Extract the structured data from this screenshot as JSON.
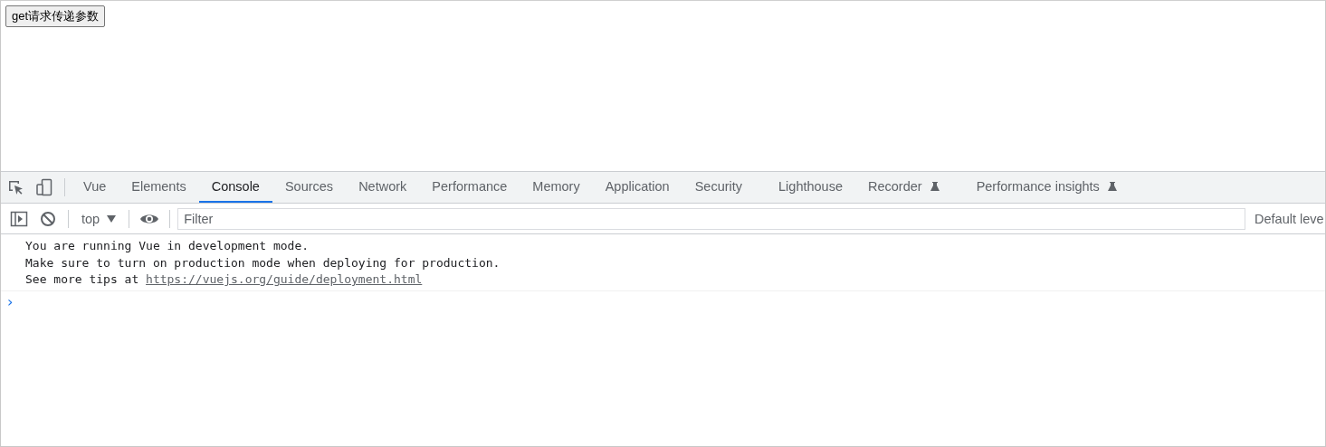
{
  "page": {
    "button": "get请求传递参数"
  },
  "devtools": {
    "tabs": [
      {
        "label": "Vue",
        "selected": false,
        "experimental": false
      },
      {
        "label": "Elements",
        "selected": false,
        "experimental": false
      },
      {
        "label": "Console",
        "selected": true,
        "experimental": false
      },
      {
        "label": "Sources",
        "selected": false,
        "experimental": false
      },
      {
        "label": "Network",
        "selected": false,
        "experimental": false
      },
      {
        "label": "Performance",
        "selected": false,
        "experimental": false
      },
      {
        "label": "Memory",
        "selected": false,
        "experimental": false
      },
      {
        "label": "Application",
        "selected": false,
        "experimental": false
      },
      {
        "label": "Security",
        "selected": false,
        "experimental": false
      },
      {
        "label": "Lighthouse",
        "selected": false,
        "experimental": false
      },
      {
        "label": "Recorder",
        "selected": false,
        "experimental": true
      },
      {
        "label": "Performance insights",
        "selected": false,
        "experimental": true
      }
    ],
    "context": "top",
    "filter": {
      "placeholder": "Filter"
    },
    "levels": "Default leve",
    "messages": [
      {
        "text": "You are running Vue in development mode."
      },
      {
        "text": "Make sure to turn on production mode when deploying for production."
      },
      {
        "text": "See more tips at ",
        "link": "https://vuejs.org/guide/deployment.html"
      }
    ],
    "prompt": "›"
  }
}
